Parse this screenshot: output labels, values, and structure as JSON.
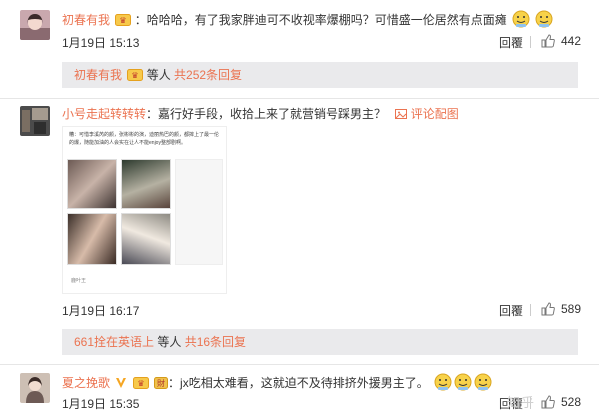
{
  "comments": [
    {
      "user": "初春有我",
      "text": "：哈哈哈，有了我家胖迪可不收视率爆棚吗？可惜盛一伦居然有点面瘫",
      "date": "1月19日 15:13",
      "reply": "回覆",
      "likes": "442",
      "emoji_count": 2,
      "sub": {
        "user": "初春有我",
        "mid": " 等人 ",
        "count": "共252条回复"
      }
    },
    {
      "user": "小号走起转转转",
      "text": "：嘉行好手段，收拾上来了就营销号踩男主？",
      "link_text": "评论配图",
      "date": "1月19日 16:17",
      "reply": "回覆",
      "likes": "589",
      "image_caption": "糟：可惜李溪芮的颜，张彬彬的演，迪丽热巴的颜，都摔上了最一伦的爆，随能加油的人会实在让人不能enjoy整部剧啊。",
      "image_footer": "鹿叶王",
      "sub": {
        "user": "661拴在英语上",
        "mid": " 等人 ",
        "count": "共16条回复"
      }
    },
    {
      "user": "夏之挽歌",
      "text": "：jx吃相太难看，这就迫不及待排挤外援男主了。",
      "date": "1月19日 15:35",
      "reply": "回覆",
      "likes": "528",
      "emoji_count": 3
    }
  ],
  "watermark": "知乎",
  "colors": {
    "username": "#eb7350",
    "subbox_bg": "#eaeaec",
    "divider": "#e6e6e6"
  },
  "icons": [
    "thumbs-up-icon",
    "vip-badge-icon",
    "emoji-face-icon",
    "image-icon",
    "verified-v-icon"
  ]
}
